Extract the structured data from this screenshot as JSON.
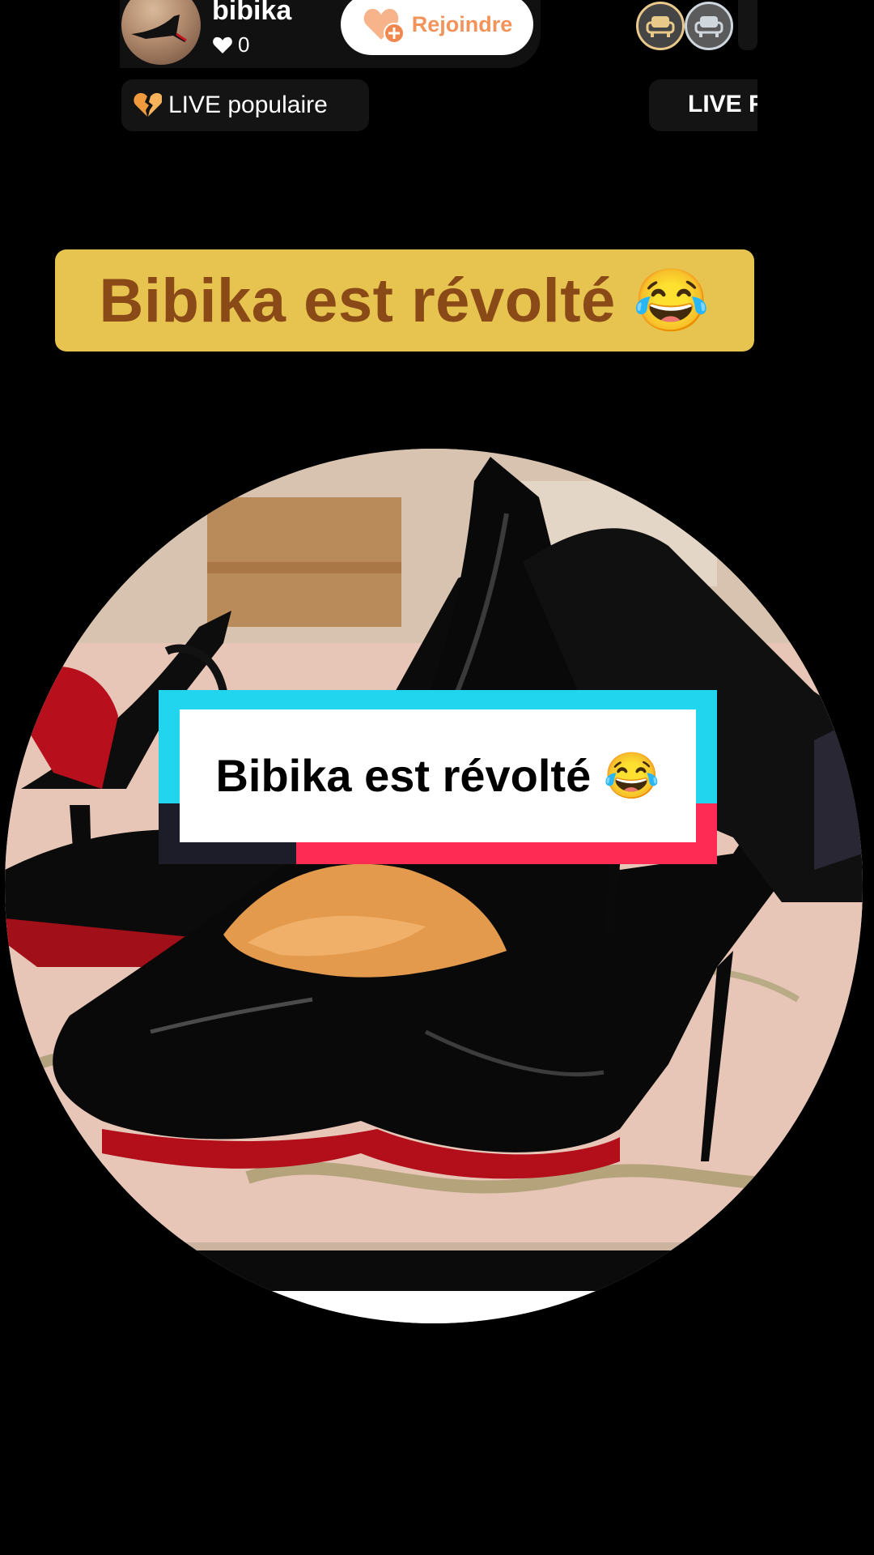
{
  "header": {
    "username": "bibika",
    "likes_count": "0",
    "join_label": "Rejoindre"
  },
  "tags": {
    "popular_label": "LIVE populaire",
    "right_label": "LIVE F"
  },
  "caption": {
    "headline": "Bibika est révolté 😂",
    "center_text": "Bibika est révolté 😂"
  },
  "colors": {
    "caption_yellow": "#e7c34f",
    "caption_brown": "#8a4a18",
    "accent_cyan": "#22d5ef",
    "accent_pink": "#fe2c55",
    "join_orange": "#f2945a"
  },
  "icons": {
    "likes": "heart-icon",
    "join": "heart-plus-icon",
    "popular": "broken-heart-icon",
    "viewers": "sofa-icon"
  }
}
